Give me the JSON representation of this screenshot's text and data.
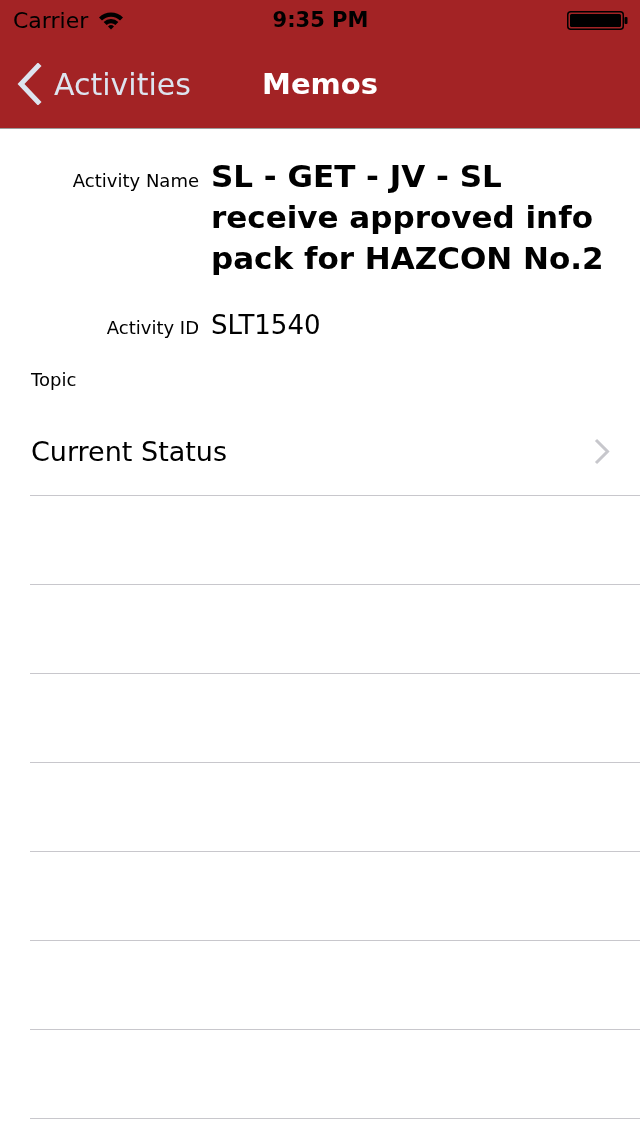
{
  "status_bar": {
    "carrier": "Carrier",
    "time": "9:35 PM"
  },
  "nav_bar": {
    "back_label": "Activities",
    "title": "Memos"
  },
  "details": [
    {
      "kind": "title",
      "label": "Activity Name",
      "value": "SL - GET - JV - SL receive approved info pack for HAZCON No.2"
    },
    {
      "kind": "plain",
      "label": "Activity ID",
      "value": "SLT1540"
    }
  ],
  "topic": {
    "label": "Topic"
  },
  "rows": [
    {
      "label": "Current Status",
      "disclosure": true
    }
  ]
}
